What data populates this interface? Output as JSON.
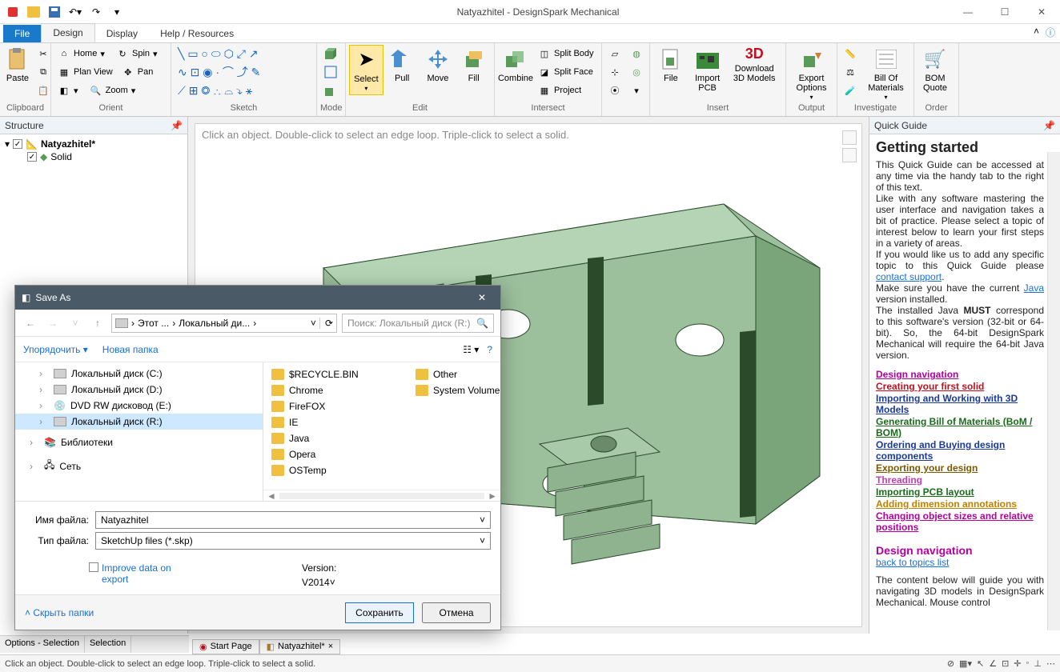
{
  "titlebar": {
    "title": "Natyazhitel - DesignSpark Mechanical"
  },
  "tabs": {
    "file": "File",
    "design": "Design",
    "display": "Display",
    "help": "Help / Resources"
  },
  "ribbon": {
    "clipboard": {
      "paste": "Paste",
      "label": "Clipboard"
    },
    "orient": {
      "home": "Home",
      "spin": "Spin",
      "planview": "Plan View",
      "pan": "Pan",
      "zoom": "Zoom",
      "label": "Orient"
    },
    "sketch": {
      "label": "Sketch"
    },
    "mode": {
      "label": "Mode"
    },
    "edit": {
      "select": "Select",
      "pull": "Pull",
      "move": "Move",
      "fill": "Fill",
      "label": "Edit"
    },
    "intersect": {
      "combine": "Combine",
      "split_body": "Split Body",
      "split_face": "Split Face",
      "project": "Project",
      "label": "Intersect"
    },
    "insert": {
      "file": "File",
      "import_pcb": "Import PCB",
      "download_3d": "Download 3D Models",
      "label": "Insert"
    },
    "output": {
      "export": "Export Options",
      "label": "Output"
    },
    "investigate": {
      "bom": "Bill Of Materials",
      "label": "Investigate"
    },
    "order": {
      "bomq": "BOM Quote",
      "label": "Order"
    }
  },
  "structure": {
    "title": "Structure",
    "root": "Natyazhitel*",
    "child": "Solid"
  },
  "viewport": {
    "hint": "Click an object. Double-click to select an edge loop. Triple-click to select a solid."
  },
  "quickguide": {
    "title": "Quick Guide",
    "heading": "Getting started",
    "p1": "This Quick Guide can be accessed at any time via the handy tab to the right of this text.",
    "p2": "Like with any software mastering the user interface and navigation takes a bit of practice. Please select a topic of interest below to learn your first steps in a variety of areas.",
    "p3a": "If you would like us to add any specific topic to this Quick Guide please ",
    "p3link": "contact support",
    "p3b": ".",
    "p4a": "Make sure you have the current ",
    "p4link": "Java",
    "p4b": " version installed.",
    "p5a": "The installed Java ",
    "p5bold": "MUST",
    "p5b": " correspond to this software's version (32-bit or 64-bit). So, the 64-bit DesignSpark Mechanical will require the 64-bit Java version.",
    "links": {
      "l1": "Design navigation",
      "l2": "Creating your first solid",
      "l3": "Importing and Working with 3D Models",
      "l4": "Generating Bill of Materials (BoM / BOM)",
      "l5": "Ordering and Buying design components",
      "l6": "Exporting your design",
      "l7": "Threading",
      "l8": "Importing PCB layout",
      "l9": "Adding dimension annotations",
      "l10": "Changing object sizes and relative positions"
    },
    "sub_heading": "Design navigation",
    "sub_link": "back to topics list",
    "sub_p": "The content below will guide you with navigating 3D models in DesignSpark Mechanical. Mouse control"
  },
  "dialog": {
    "title": "Save As",
    "crumb1": "Этот ...",
    "crumb2": "Локальный ди...",
    "search_ph": "Поиск: Локальный диск (R:)",
    "organize": "Упорядочить",
    "newfolder": "Новая папка",
    "side": {
      "c": "Локальный диск (C:)",
      "d": "Локальный диск (D:)",
      "e": "DVD RW дисковод (E:)",
      "r": "Локальный диск (R:)",
      "lib": "Библиотеки",
      "net": "Сеть"
    },
    "files": {
      "f1": "$RECYCLE.BIN",
      "f2": "Chrome",
      "f3": "FireFOX",
      "f4": "IE",
      "f5": "Java",
      "f6": "Opera",
      "f7": "OSTemp",
      "f8": "Other",
      "f9": "System Volume"
    },
    "name_label": "Имя файла:",
    "name_value": "Natyazhitel",
    "type_label": "Тип файла:",
    "type_value": "SketchUp files (*.skp)",
    "improve": "Improve data on export",
    "version_label": "Version:",
    "version_value": "V2014",
    "hide": "Скрыть папки",
    "save": "Сохранить",
    "cancel": "Отмена"
  },
  "side_tabs": {
    "t1": "Options - Selection",
    "t2": "Selection"
  },
  "doc_tabs": {
    "start": "Start Page",
    "doc": "Natyazhitel*"
  },
  "status": {
    "msg": "Click an object. Double-click to select an edge loop. Triple-click to select a solid."
  }
}
